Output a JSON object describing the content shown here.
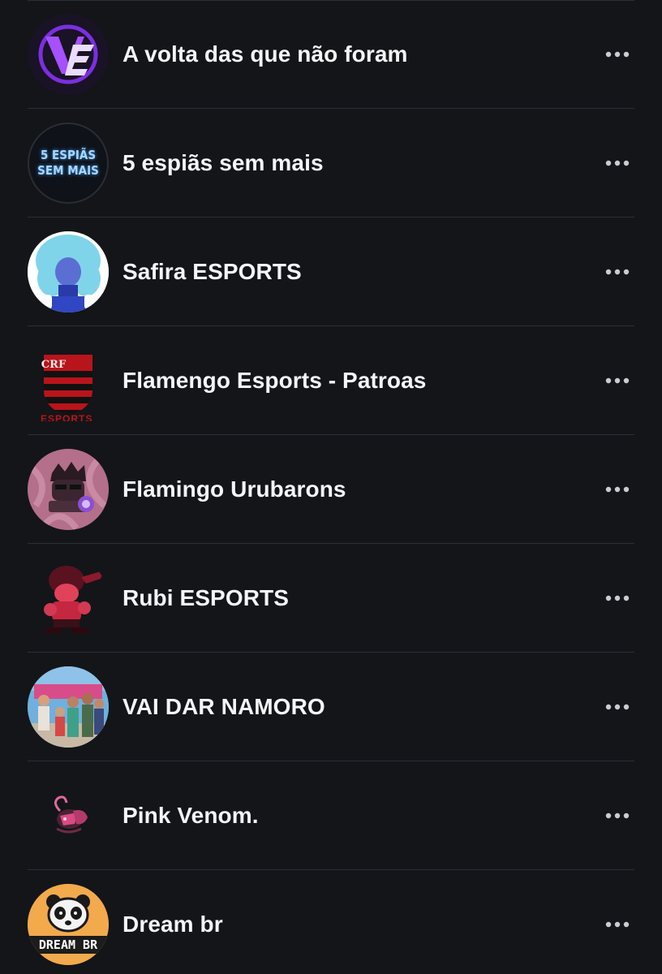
{
  "groups": [
    {
      "name": "A volta das que não foram",
      "avatar_icon": "ve-logo-avatar",
      "avatar_text": ""
    },
    {
      "name": "5 espiãs sem mais",
      "avatar_icon": "neon-text-avatar",
      "avatar_text": "5 ESPIÃS SEM MAIS"
    },
    {
      "name": "Safira ESPORTS",
      "avatar_icon": "blue-character-avatar",
      "avatar_text": ""
    },
    {
      "name": "Flamengo Esports - Patroas",
      "avatar_icon": "flamengo-crest-avatar",
      "avatar_text": "ESPORTS"
    },
    {
      "name": "Flamingo Urubarons",
      "avatar_icon": "flamingo-mascot-avatar",
      "avatar_text": ""
    },
    {
      "name": "Rubi ESPORTS",
      "avatar_icon": "red-character-avatar",
      "avatar_text": ""
    },
    {
      "name": "VAI DAR NAMORO",
      "avatar_icon": "group-photo-avatar",
      "avatar_text": ""
    },
    {
      "name": "Pink Venom.",
      "avatar_icon": "pink-logo-avatar",
      "avatar_text": ""
    },
    {
      "name": "Dream br",
      "avatar_icon": "panda-logo-avatar",
      "avatar_text": "DREAM BR"
    }
  ],
  "more_icon": "more-options-icon",
  "colors": {
    "background": "#131519",
    "divider": "#2b2e35",
    "text": "#f4f5f7",
    "icon": "#c9ccd2"
  }
}
